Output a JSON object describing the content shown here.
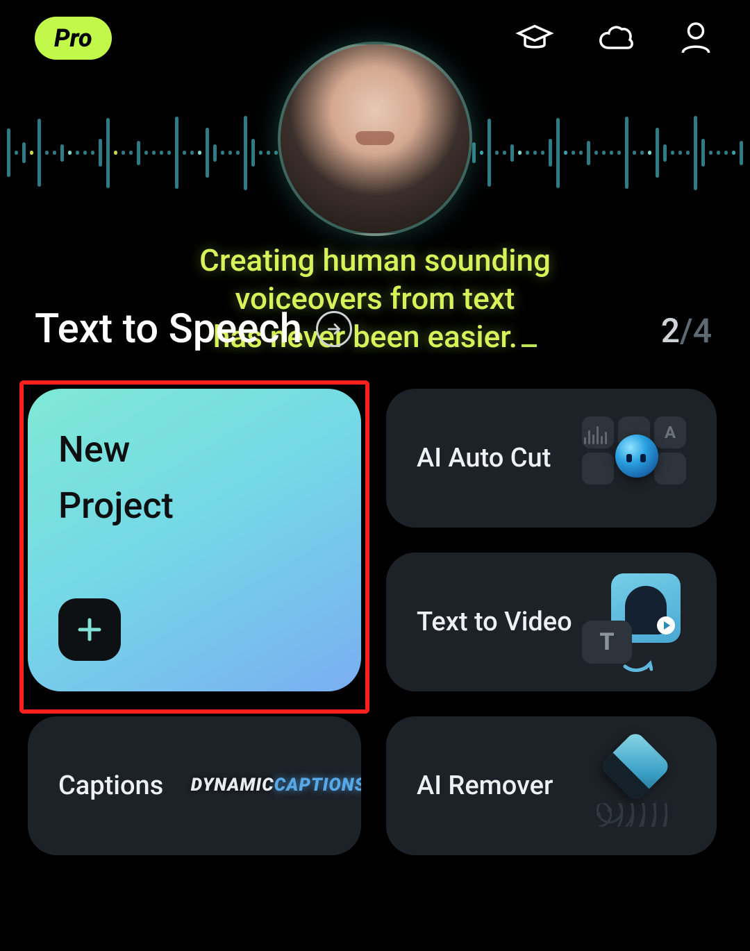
{
  "header": {
    "pro_label": "Pro",
    "icons": [
      "graduation-cap-icon",
      "cloud-icon",
      "profile-icon"
    ]
  },
  "hero": {
    "tagline_line1": "Creating human sounding",
    "tagline_line2": "voiceovers from text",
    "tagline_line3": "has never been easier.",
    "section_title": "Text to Speech",
    "page_current": "2",
    "page_sep": "/",
    "page_total": "4"
  },
  "tiles": {
    "new_project": {
      "label": "New\nProject"
    },
    "ai_auto_cut": {
      "label": "AI Auto Cut"
    },
    "text_to_video": {
      "label": "Text to Video"
    },
    "captions": {
      "label": "Captions",
      "thumb_line1": "DYNAMIC",
      "thumb_line2": "CAPTIONS"
    },
    "ai_remover": {
      "label": "AI Remover"
    }
  }
}
